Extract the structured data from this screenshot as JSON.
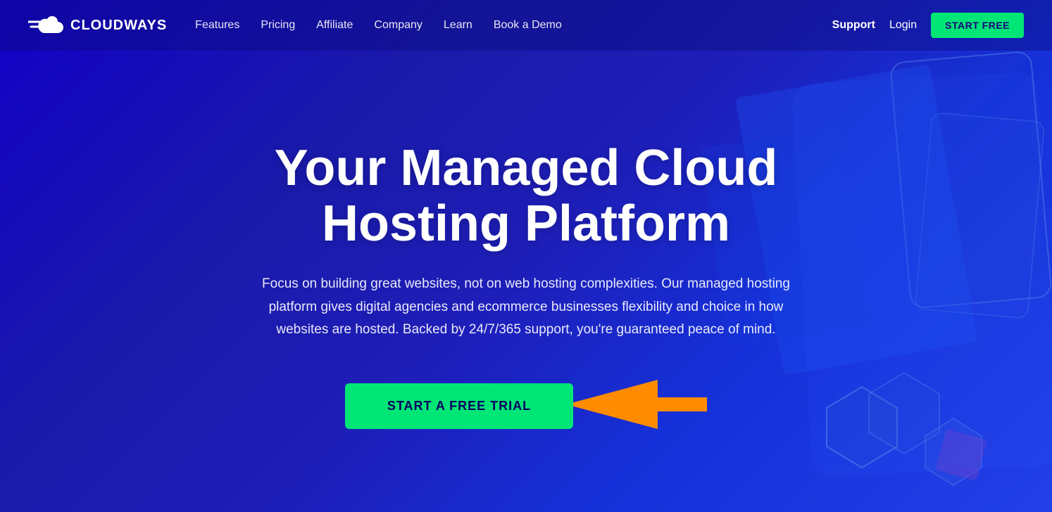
{
  "brand": {
    "name": "CLOUDWAYS"
  },
  "navbar": {
    "links": [
      {
        "id": "features",
        "label": "Features"
      },
      {
        "id": "pricing",
        "label": "Pricing"
      },
      {
        "id": "affiliate",
        "label": "Affiliate"
      },
      {
        "id": "company",
        "label": "Company"
      },
      {
        "id": "learn",
        "label": "Learn"
      },
      {
        "id": "book-demo",
        "label": "Book a Demo"
      }
    ],
    "right": {
      "support": "Support",
      "login": "Login",
      "start_free": "START FREE"
    }
  },
  "hero": {
    "title": "Your Managed Cloud Hosting Platform",
    "subtitle": "Focus on building great websites, not on web hosting complexities. Our managed hosting platform gives digital agencies and ecommerce businesses flexibility and choice in how websites are hosted. Backed by 24/7/365 support, you're guaranteed peace of mind.",
    "cta_button": "START A FREE TRIAL"
  },
  "colors": {
    "accent_green": "#00e676",
    "bg_deep_blue": "#0d0d99",
    "bg_royal_blue": "#1a1aaa",
    "arrow_orange": "#ff8c00",
    "text_white": "#ffffff"
  }
}
